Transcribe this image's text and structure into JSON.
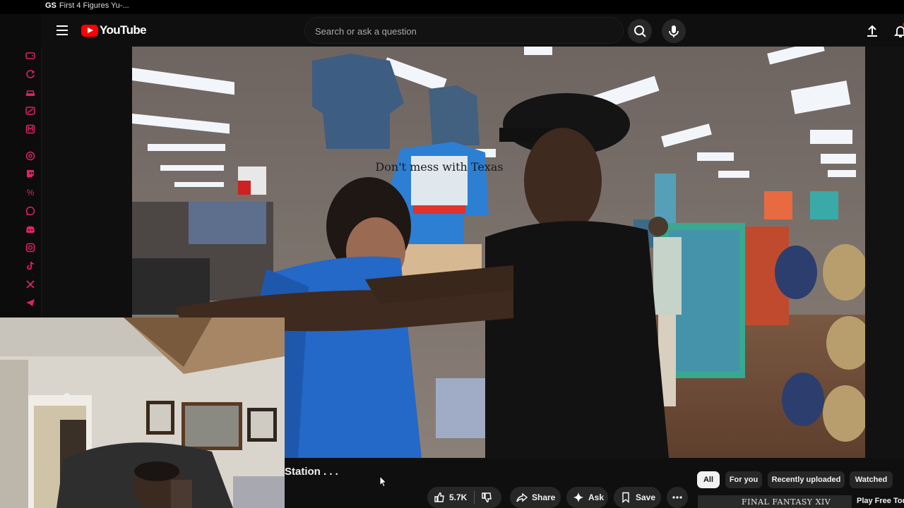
{
  "browser": {
    "tab_icon_text": "GS",
    "tab_title": "First 4 Figures Yu-..."
  },
  "header": {
    "logo_text": "YouTube",
    "search_placeholder": "Search or ask a question"
  },
  "sidebar_icons": [
    "game-icon",
    "refresh-icon",
    "car-icon",
    "gamepad-icon",
    "box-icon",
    "threads-icon",
    "twitch-icon",
    "percent-icon",
    "whatsapp-icon",
    "discord-icon",
    "instagram-icon",
    "tiktok-icon",
    "x-icon",
    "telegram-icon"
  ],
  "video": {
    "shirt_text": "Don't mess with Texas",
    "title_fragment": "Station . . ."
  },
  "actions": {
    "like_count": "5.7K",
    "share_label": "Share",
    "ask_label": "Ask",
    "save_label": "Save"
  },
  "chips": [
    "All",
    "For you",
    "Recently uploaded",
    "Watched"
  ],
  "recommendation": {
    "thumb_text": "FINAL FANTASY XIV",
    "title": "Play Free Tod"
  },
  "colors": {
    "accent": "#e0245e",
    "brand_red": "#ff0000",
    "background": "#0f0f0f",
    "chip_bg": "#272727"
  }
}
